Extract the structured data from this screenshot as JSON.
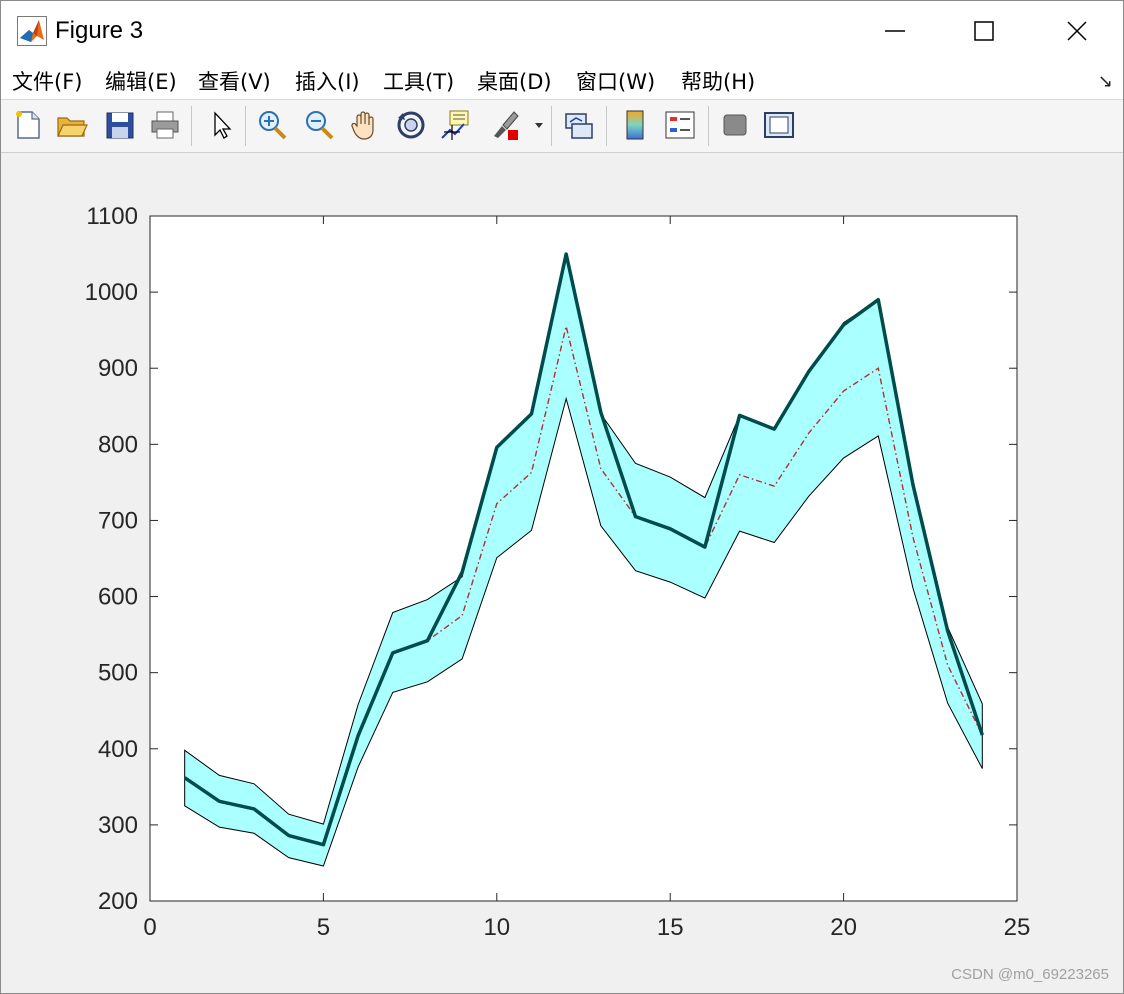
{
  "window": {
    "title": "Figure 3",
    "icon": "matlab-icon",
    "controls": [
      "minimize-icon",
      "maximize-icon",
      "close-icon"
    ]
  },
  "menu": {
    "items": [
      "文件(F)",
      "编辑(E)",
      "查看(V)",
      "插入(I)",
      "工具(T)",
      "桌面(D)",
      "窗口(W)",
      "帮助(H)"
    ],
    "dock_icon": "↘"
  },
  "toolbar": {
    "tools": [
      "new-figure-icon",
      "open-file-icon",
      "save-icon",
      "print-icon",
      "edit-plot-icon",
      "zoom-in-icon",
      "zoom-out-icon",
      "pan-icon",
      "rotate-3d-icon",
      "data-cursor-icon",
      "brush-icon",
      "link-plot-icon",
      "insert-colorbar-icon",
      "insert-legend-icon",
      "hide-plot-tools-icon",
      "show-plot-tools-icon"
    ]
  },
  "watermark": "CSDN @m0_69223265",
  "chart_data": {
    "type": "area",
    "title": "",
    "xlabel": "",
    "ylabel": "",
    "xlim": [
      0,
      25
    ],
    "ylim": [
      200,
      1100
    ],
    "xticks": [
      0,
      5,
      10,
      15,
      20,
      25
    ],
    "yticks": [
      200,
      300,
      400,
      500,
      600,
      700,
      800,
      900,
      1000,
      1100
    ],
    "grid": false,
    "x": [
      1,
      2,
      3,
      4,
      5,
      6,
      7,
      8,
      9,
      10,
      11,
      12,
      13,
      14,
      15,
      16,
      17,
      18,
      19,
      20,
      21,
      22,
      23,
      24
    ],
    "band": {
      "upper": [
        398,
        365,
        354,
        314,
        301,
        458,
        579,
        596,
        626,
        797,
        840,
        1050,
        840,
        775,
        757,
        730,
        838,
        820,
        894,
        960,
        990,
        745,
        560,
        459
      ],
      "lower": [
        325,
        297,
        289,
        257,
        246,
        376,
        474,
        488,
        518,
        651,
        687,
        860,
        693,
        634,
        619,
        598,
        686,
        671,
        732,
        782,
        811,
        611,
        460,
        374
      ],
      "fill": "#aaffff",
      "edge": "#000000"
    },
    "series": [
      {
        "values": [
          362,
          331,
          321,
          286,
          274,
          417,
          526,
          542,
          632,
          796,
          840,
          1050,
          842,
          705,
          689,
          665,
          838,
          820,
          896,
          957,
          990,
          747,
          555,
          418
        ],
        "color": "#004c4c",
        "style": "solid-thick"
      },
      {
        "values": [
          362,
          331,
          321,
          286,
          274,
          417,
          526,
          542,
          575,
          722,
          763,
          955,
          768,
          705,
          689,
          665,
          760,
          745,
          815,
          870,
          900,
          678,
          510,
          418
        ],
        "color": "#b03030",
        "style": "dash-dot"
      }
    ]
  }
}
